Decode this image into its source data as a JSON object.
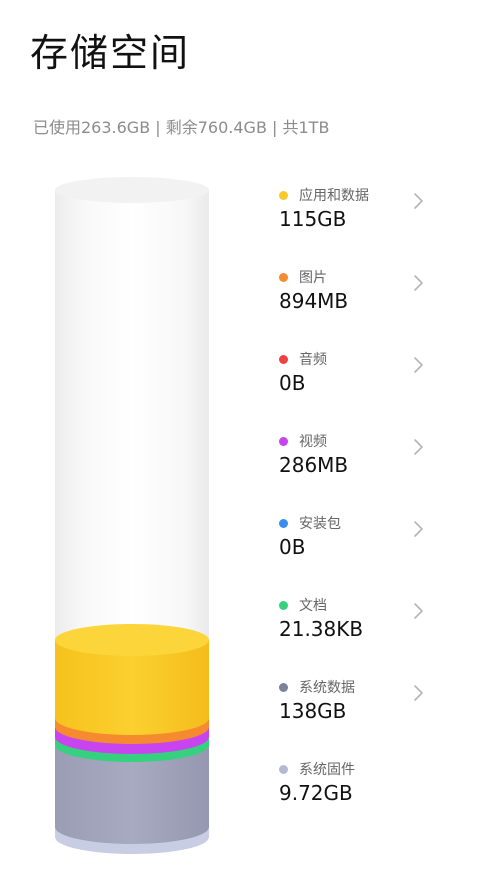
{
  "header": {
    "title": "存储空间",
    "summary": "已使用263.6GB | 剩余760.4GB | 共1TB"
  },
  "categories": [
    {
      "label": "应用和数据",
      "size": "115GB",
      "color": "#f9c92c",
      "icon": "yellow-dot",
      "chevron": true
    },
    {
      "label": "图片",
      "size": "894MB",
      "color": "#f58b2e",
      "icon": "orange-dot",
      "chevron": true
    },
    {
      "label": "音频",
      "size": "0B",
      "color": "#ee4242",
      "icon": "red-dot",
      "chevron": true
    },
    {
      "label": "视频",
      "size": "286MB",
      "color": "#c744ee",
      "icon": "purple-dot",
      "chevron": true
    },
    {
      "label": "安装包",
      "size": "0B",
      "color": "#3a8fee",
      "icon": "blue-dot",
      "chevron": true
    },
    {
      "label": "文档",
      "size": "21.38KB",
      "color": "#36d17e",
      "icon": "green-dot",
      "chevron": true
    },
    {
      "label": "系统数据",
      "size": "138GB",
      "color": "#7c8299",
      "icon": "gray-dot",
      "chevron": true
    },
    {
      "label": "系统固件",
      "size": "9.72GB",
      "color": "#b3b9d2",
      "icon": "lavender-dot",
      "chevron": false
    }
  ]
}
